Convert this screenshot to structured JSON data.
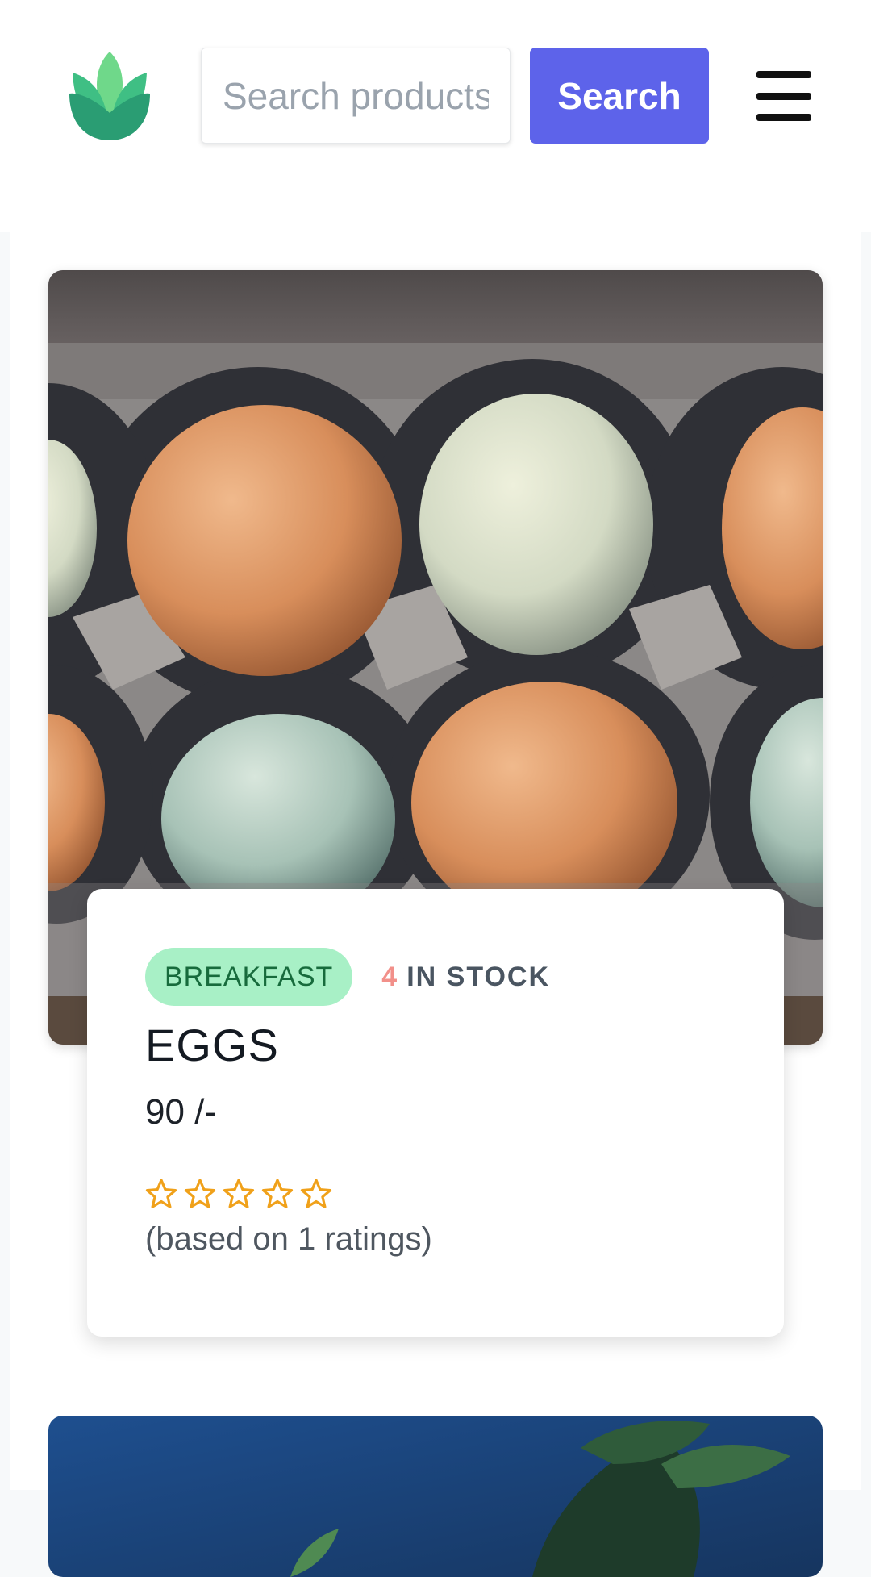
{
  "header": {
    "logo_icon": "leaf-logo-icon",
    "search_placeholder": "Search products",
    "search_button_label": "Search",
    "menu_icon": "hamburger-menu-icon"
  },
  "product": {
    "category": "BREAKFAST",
    "stock_count": "4",
    "stock_label": "IN STOCK",
    "name": "EGGS",
    "price": "90 /-",
    "rating": 0,
    "rating_max": 5,
    "rating_text": "(based on 1 ratings)",
    "image_icon": "eggs-photo"
  },
  "colors": {
    "accent": "#5d63ea",
    "badge_bg": "#a8f0c6",
    "badge_text": "#176b3c",
    "stock_count": "#f2908a",
    "star": "#f0a11a"
  }
}
